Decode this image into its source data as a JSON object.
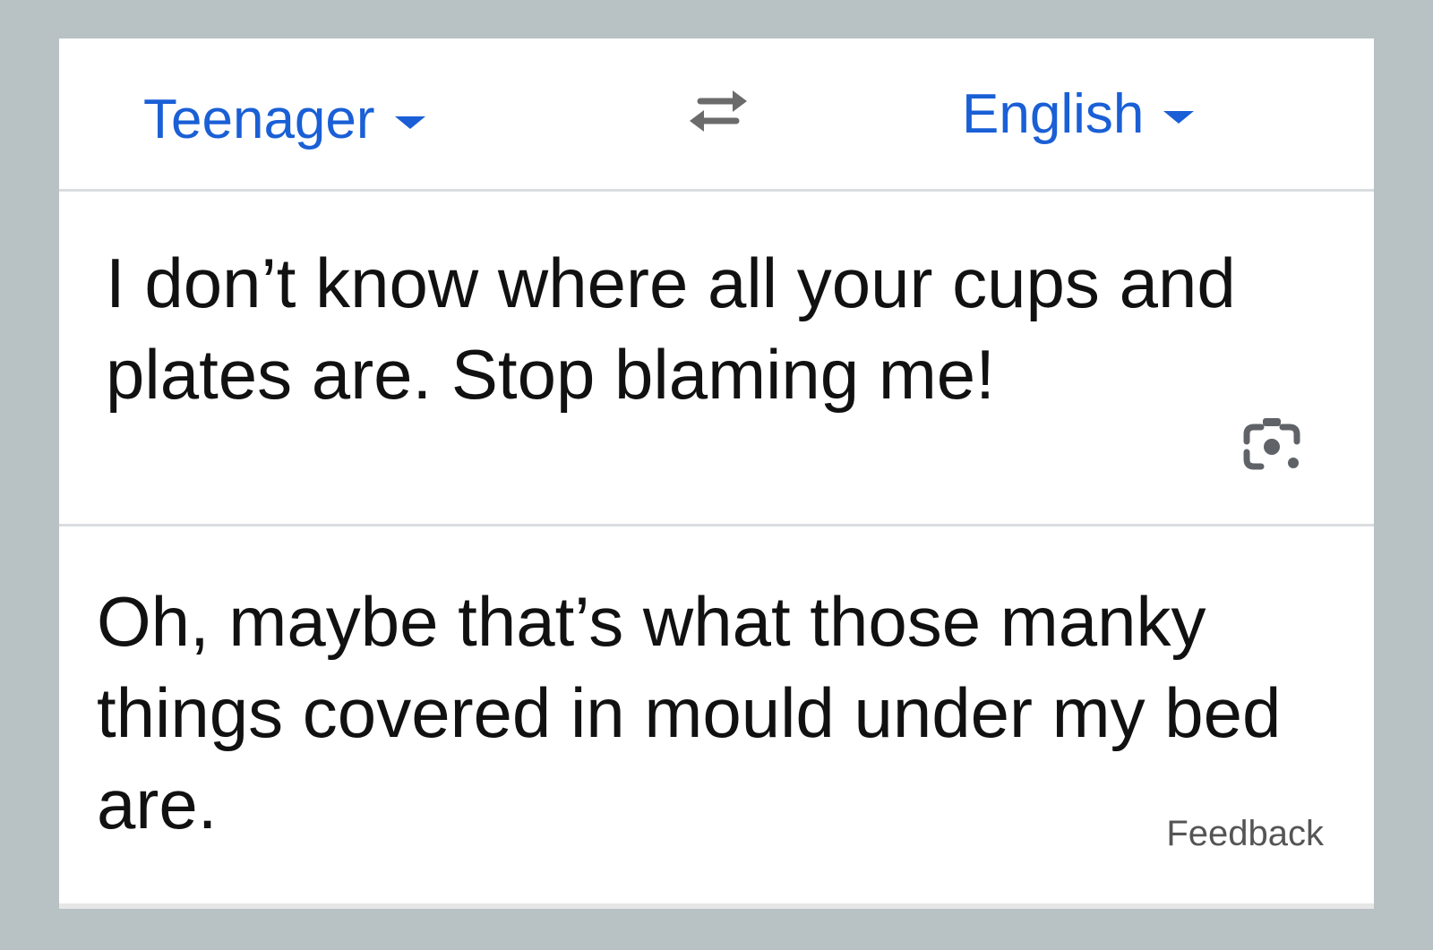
{
  "language_bar": {
    "source_language": "Teenager",
    "target_language": "English",
    "swap_icon": "swap-arrows-icon",
    "accent_color": "#1a5fd6"
  },
  "input": {
    "text": "I don’t know where all your cups and plates are. Stop blaming me!",
    "camera_icon": "lens-camera-icon"
  },
  "output": {
    "text": "Oh, maybe that’s what those manky things covered in mould under my bed are.",
    "feedback_label": "Feedback"
  },
  "colors": {
    "background": "#b8c2c5",
    "panel": "#ffffff",
    "text": "#111111"
  }
}
